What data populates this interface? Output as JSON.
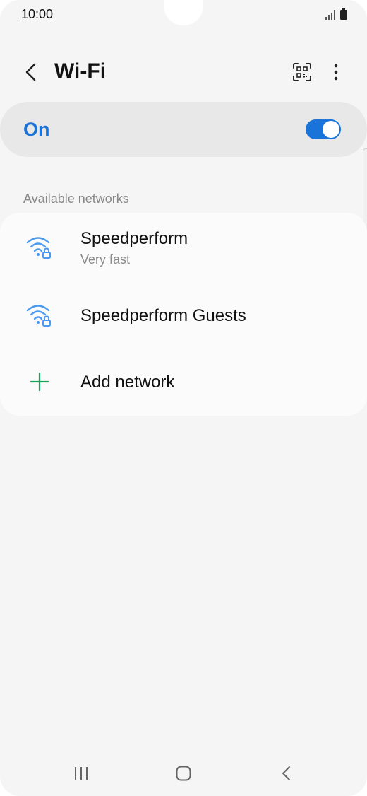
{
  "status_bar": {
    "time": "10:00",
    "signal_icon": "signal-icon",
    "battery_icon": "battery-icon"
  },
  "header": {
    "title": "Wi-Fi",
    "back_icon": "chevron-left-icon",
    "qr_icon": "qr-scan-icon",
    "more_icon": "more-vertical-icon"
  },
  "master_switch": {
    "label": "On",
    "checked": true
  },
  "section": {
    "title": "Available networks"
  },
  "networks": [
    {
      "name": "Speedperform",
      "status": "Very fast",
      "icon": "wifi-lock-icon"
    },
    {
      "name": "Speedperform Guests",
      "icon": "wifi-lock-icon"
    }
  ],
  "add_network": {
    "label": "Add network",
    "icon": "plus-icon"
  },
  "colors": {
    "accent": "#1a73d9",
    "wifi_icon": "#4a9af0",
    "add_icon": "#1aa05a",
    "background": "#f5f5f5",
    "card": "#fbfbfb"
  },
  "nav_bar": {
    "recents_icon": "recents-icon",
    "home_icon": "home-icon",
    "back_icon": "back-icon"
  }
}
